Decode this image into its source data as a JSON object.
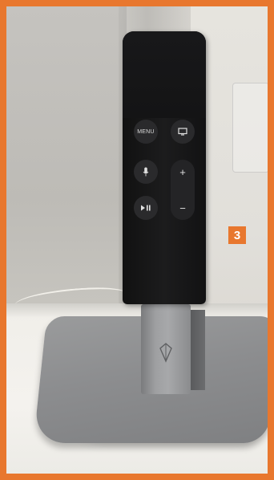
{
  "remote": {
    "menu_label": "MENU",
    "tv_icon": "tv-icon",
    "mic_icon": "microphone-icon",
    "plus_symbol": "+",
    "play_pause_icon": "play-pause-icon",
    "minus_symbol": "−"
  },
  "badge": {
    "number": "3",
    "color": "#e8772e"
  },
  "colors": {
    "frame": "#e8772e",
    "remote_body": "#151516",
    "stand": "#8c8d8f"
  }
}
